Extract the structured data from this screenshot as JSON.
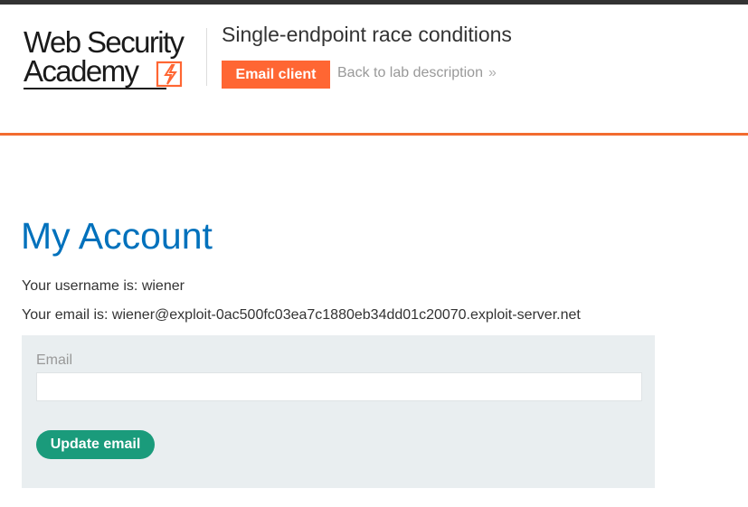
{
  "header": {
    "logo": {
      "line1": "Web Security",
      "line2": "Academy"
    },
    "lab_title": "Single-endpoint race conditions",
    "email_client_label": "Email client",
    "back_link_label": "Back to lab description"
  },
  "main": {
    "title": "My Account",
    "username_line": "Your username is: wiener",
    "email_line": "Your email is: wiener@exploit-0ac500fc03ea7c1880eb34dd01c20070.exploit-server.net",
    "form": {
      "email_label": "Email",
      "email_value": "",
      "update_button_label": "Update email"
    }
  },
  "colors": {
    "accent": "#ff6633",
    "title_blue": "#0071bc",
    "update_green": "#1a9b7b",
    "panel_bg": "#e9eef0"
  },
  "icons": {
    "back_link": "double-chevron-right-icon",
    "logo_mark": "lightning-bolt-icon"
  }
}
